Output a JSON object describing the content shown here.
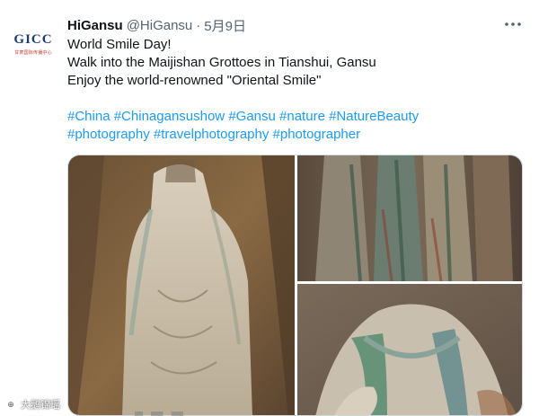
{
  "tweet": {
    "author_name": "HiGansu",
    "handle": "@HiGansu",
    "separator": "·",
    "date": "5月9日",
    "more_icon": "more-dots-icon",
    "lines": [
      "World Smile Day!",
      "Walk into the Maijishan Grottoes in Tianshui, Gansu",
      "Enjoy the world-renowned \"Oriental Smile\""
    ],
    "hashtag_lines": [
      [
        "#China",
        "#Chinagansushow",
        "#Gansu",
        "#nature",
        "#NatureBeauty"
      ],
      [
        "#photography",
        "#travelphotography",
        "#photographer"
      ]
    ],
    "hashtag_color": "#1d9bf0"
  },
  "avatar": {
    "logo_text": "GICC",
    "logo_subtext": "甘肃国际传播中心"
  },
  "media": {
    "photos": [
      {
        "alt": "standing-buddha-statue-photo"
      },
      {
        "alt": "painted-statue-robes-photo"
      },
      {
        "alt": "statue-torso-with-hand-photo"
      }
    ]
  },
  "watermark": {
    "text": "大鹅锦瑶"
  }
}
